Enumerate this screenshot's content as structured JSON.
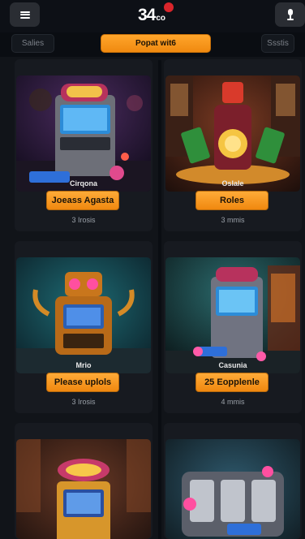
{
  "header": {
    "logo_text": "34",
    "logo_sub": "co",
    "menu_icon": "hamburger-icon",
    "download_icon": "download-icon"
  },
  "tabs": {
    "left_label": "Salies",
    "center_label": "Popat wit6",
    "right_label": "Ssstis"
  },
  "cards": [
    {
      "name": "Cirqona",
      "button": "Joeass Agasta",
      "meta": "3 Irosis",
      "image": "slot-machine-blue-screen"
    },
    {
      "name": "Oslale",
      "button": "Roles",
      "meta": "3 mmis",
      "image": "casino-cards-wheel"
    },
    {
      "name": "Mrio",
      "button": "Please uplols",
      "meta": "3 Irosis",
      "image": "golden-robot-slot"
    },
    {
      "name": "Casunia",
      "button": "25 Eopplenle",
      "meta": "4 mmis",
      "image": "cabinet-slot-machine"
    },
    {
      "name": "",
      "button": "",
      "meta": "",
      "image": "gold-slot-machine"
    },
    {
      "name": "",
      "button": "",
      "meta": "",
      "image": "drum-slot-machine"
    }
  ],
  "colors": {
    "accent": "#f59a1f",
    "background": "#0a0d12",
    "card": "#171a20"
  }
}
